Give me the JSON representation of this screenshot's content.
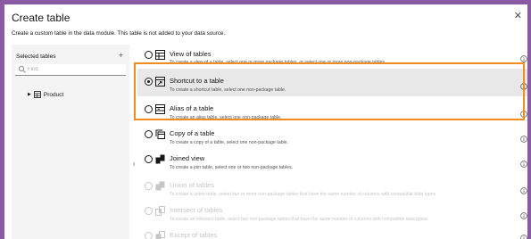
{
  "dialog": {
    "title": "Create table",
    "close_icon": "close-icon",
    "description": "Create a custom table in the data module. This table is not added to your data source."
  },
  "left_panel": {
    "header": "Selected tables",
    "add_label": "+",
    "search": {
      "placeholder": "Find",
      "value": ""
    },
    "tree": [
      {
        "label": "Product",
        "icon": "table-icon"
      }
    ]
  },
  "options": [
    {
      "title": "View of tables",
      "subtitle": "To create a view of a table, select one or more package tables, or select one or more non-package tables.",
      "checked": false,
      "disabled": false,
      "icon": "view-of-tables-icon"
    },
    {
      "title": "Shortcut to a table",
      "subtitle": "To create a shortcut table, select one non-package table.",
      "checked": true,
      "disabled": false,
      "icon": "shortcut-table-icon"
    },
    {
      "title": "Alias of a table",
      "subtitle": "To create an alias table, select one non-package table.",
      "checked": false,
      "disabled": false,
      "icon": "alias-table-icon"
    },
    {
      "title": "Copy of a table",
      "subtitle": "To create a copy of a table, select one non-package table.",
      "checked": false,
      "disabled": false,
      "icon": "copy-table-icon"
    },
    {
      "title": "Joined view",
      "subtitle": "To create a join table, select one or two non-package tables.",
      "checked": false,
      "disabled": false,
      "icon": "joined-view-icon"
    },
    {
      "title": "Union of tables",
      "subtitle": "To create a union table, select two or more non-package tables that have the same number of columns with compatible data types.",
      "checked": false,
      "disabled": true,
      "icon": "union-tables-icon"
    },
    {
      "title": "Intersect of tables",
      "subtitle": "To create an intersect table, select two non-package tables that have the same number of columns with compatible data types.",
      "checked": false,
      "disabled": true,
      "icon": "intersect-tables-icon"
    },
    {
      "title": "Except of tables",
      "subtitle": "",
      "checked": false,
      "disabled": true,
      "icon": "except-tables-icon"
    }
  ],
  "colors": {
    "highlight": "#f28c1e",
    "backdrop": "#8a5aa5",
    "selected_row": "#e8e8e8"
  }
}
